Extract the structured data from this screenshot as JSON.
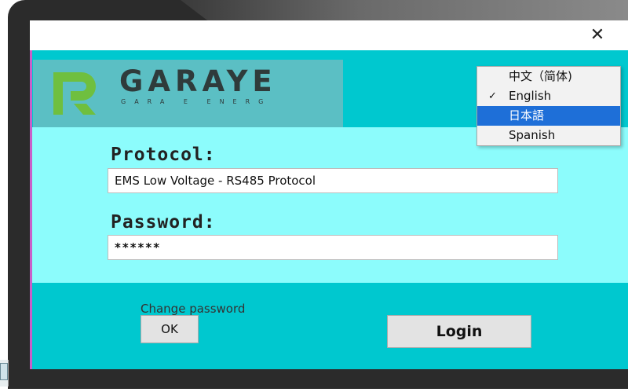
{
  "window": {
    "close_symbol": "✕"
  },
  "brand": {
    "name": "GARAYE",
    "subtitle": "GARA E ENERG"
  },
  "form": {
    "protocol_label": "Protocol:",
    "protocol_value": "EMS Low Voltage - RS485 Protocol",
    "password_label": "Password:",
    "password_value": "******"
  },
  "actions": {
    "change_password": "Change password",
    "ok": "OK",
    "login": "Login"
  },
  "language_menu": {
    "items": [
      {
        "label": "中文（简体)",
        "checked": false,
        "highlighted": false
      },
      {
        "label": "English",
        "checked": true,
        "highlighted": false
      },
      {
        "label": "日本語",
        "checked": false,
        "highlighted": true
      },
      {
        "label": "Spanish",
        "checked": false,
        "highlighted": false
      }
    ],
    "check_mark": "✓"
  },
  "colors": {
    "window_bg": "#00c8cf",
    "form_bg": "#8cfcfc",
    "logo_panel": "#5bbfc4",
    "logo_green": "#6fbf3f",
    "highlight": "#1e6fd8"
  },
  "icons": {
    "logo": "garaye-logo-icon",
    "close": "close-icon",
    "check": "check-icon"
  }
}
